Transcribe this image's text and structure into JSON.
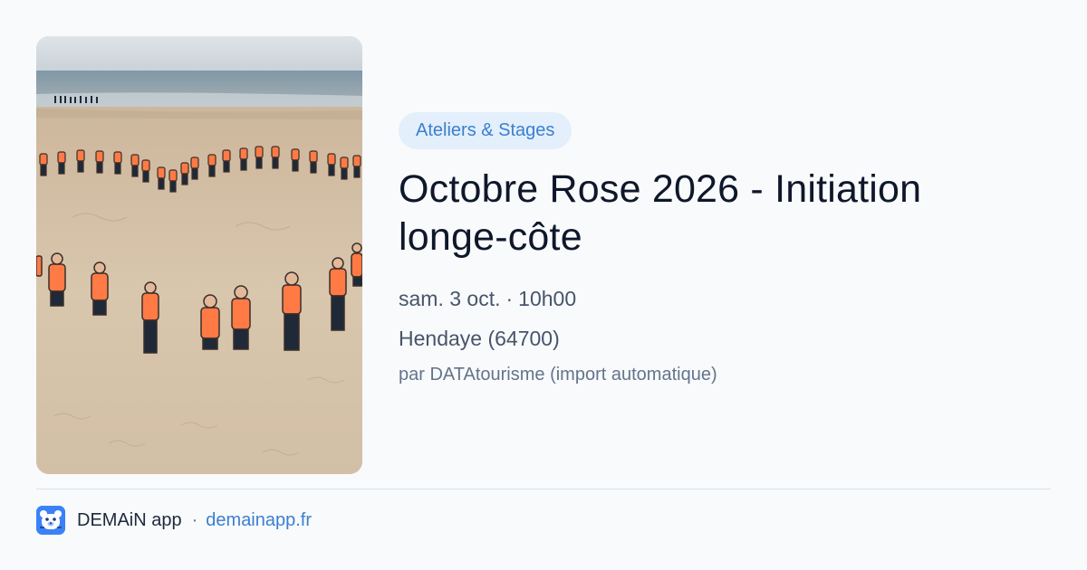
{
  "event": {
    "category": "Ateliers & Stages",
    "title": "Octobre Rose 2026 - Initiation longe-côte",
    "date": "sam. 3 oct.",
    "separator": "·",
    "time": "10h00",
    "location": "Hendaye (64700)",
    "author": "par DATAtourisme (import automatique)",
    "image_icon": "beach-photo"
  },
  "footer": {
    "app_icon": "bear-face-icon",
    "app_name": "DEMAiN app",
    "separator": "·",
    "link": "demainapp.fr"
  },
  "colors": {
    "accent": "#3b7fd0",
    "tag_bg": "#e3effb",
    "shirt": "#ff7a45"
  }
}
